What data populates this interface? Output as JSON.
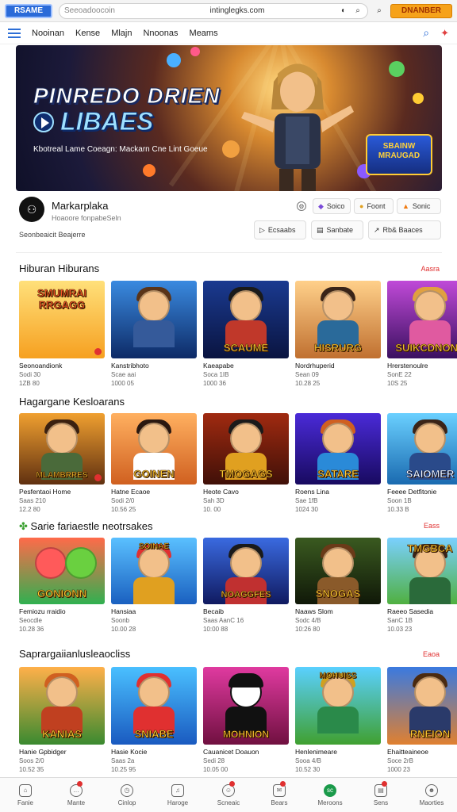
{
  "browser": {
    "logo": "RSAME",
    "search_placeholder": "Seeoadoocoin",
    "url": "intinglegks.com",
    "brand_button": "DNANBER",
    "icons": [
      "pie-chart-icon",
      "search-icon",
      "search-icon",
      "brand-logo"
    ]
  },
  "nav": {
    "items": [
      "Nooinan",
      "Kense",
      "Mlajn",
      "Nnoonas",
      "Meams"
    ],
    "icons": [
      "menu-icon",
      "search-icon",
      "notification-icon"
    ]
  },
  "hero": {
    "title_line1": "PINREDO DRIEN",
    "title_line2": "LIBAES",
    "subtitle": "Kbotreal Lame Coeagn: Mackarn Cne Lint Goeue",
    "sticker": "SBAINW MRAUGAD",
    "colors": {
      "accent": "#9fe0ff",
      "sticker": "#ffd23a"
    }
  },
  "channel": {
    "name": "Markarplaka",
    "subtitle": "Hoaoore fonpabeSeln",
    "description": "Seonbeaicit Beajerre",
    "buttons_top": [
      "Soico",
      "Foont",
      "Sonic"
    ],
    "buttons_bottom": [
      "Ecsaabs",
      "Sanbate",
      "Rb& Baaces"
    ]
  },
  "sections": [
    {
      "title": "Hiburan Hiburans",
      "more": "Aasra",
      "cards": [
        {
          "label": "SMUMRAI RRGAGG",
          "title": "Seonoandionk",
          "meta1": "Sodi 30",
          "meta2": "1ZB 80"
        },
        {
          "label": "",
          "title": "Kanstribhoto",
          "meta1": "Scae aai",
          "meta2": "1000 05"
        },
        {
          "label": "SCAUME",
          "title": "Kaeapabe",
          "meta1": "Soca 1IB",
          "meta2": "1000 36"
        },
        {
          "label": "HISRURG",
          "title": "Nordrhuperid",
          "meta1": "Sean 09",
          "meta2": "10.28 25"
        },
        {
          "label": "SUIKCDNONE",
          "title": "Hrerstenoulre",
          "meta1": "SonE 22",
          "meta2": "10S 25"
        }
      ]
    },
    {
      "title": "Hagargane Kesloarans",
      "more": "",
      "cards": [
        {
          "label": "MLAMBRRES",
          "title": "Pesfentaoi Home",
          "meta1": "Saas 210",
          "meta2": "12.2 80"
        },
        {
          "label": "GOINEN",
          "title": "Hatne Ecaoe",
          "meta1": "Sodi 2/0",
          "meta2": "10.56 25"
        },
        {
          "label": "TMOGAGS",
          "title": "Heote Cavo",
          "meta1": "Sah 3D",
          "meta2": "10. 00"
        },
        {
          "label": "SATARE",
          "title": "Roens Lina",
          "meta1": "Sae 1fB",
          "meta2": "1024 30"
        },
        {
          "label": "SAIOMER",
          "title": "Feeee Detfitonie",
          "meta1": "Soon 1B",
          "meta2": "10.33 B"
        }
      ]
    },
    {
      "title": "Sarie fariaestle neotrsakes",
      "more": "Eass",
      "cards": [
        {
          "label": "GONIONN",
          "title": "Femiozu rraidio",
          "meta1": "Seocdle",
          "meta2": "10.28 36"
        },
        {
          "label": "SOINAE",
          "title": "Hansiaa",
          "meta1": "Soonb",
          "meta2": "10.00 28"
        },
        {
          "label": "NOAGGFES",
          "title": "Becaib",
          "meta1": "Saas AanC 16",
          "meta2": "10:00 88"
        },
        {
          "label": "SNOGAS",
          "title": "Naaws Slom",
          "meta1": "Sodc 4/B",
          "meta2": "10:26 80"
        },
        {
          "label": "TMGBCA",
          "title": "Raeeo Sasedia",
          "meta1": "SanC 1B",
          "meta2": "10.03 23"
        }
      ]
    },
    {
      "title": "Saprargaiianlusleaocliss",
      "more": "Eaoa",
      "cards": [
        {
          "label": "KANIAS",
          "title": "Hanie Gpbidger",
          "meta1": "Soos 2/0",
          "meta2": "10.52 35"
        },
        {
          "label": "SNIABE",
          "title": "Hasie Kocie",
          "meta1": "Saas 2a",
          "meta2": "10.25 95"
        },
        {
          "label": "MOHNION",
          "title": "Cauanicet Doauon",
          "meta1": "Sedi 28",
          "meta2": "10.05 00"
        },
        {
          "label": "MOHUISS",
          "title": "Henlenimeare",
          "meta1": "Sooa 4/B",
          "meta2": "10.52 30"
        },
        {
          "label": "RNEION",
          "title": "Ehaitteaineoe",
          "meta1": "Soce 2rB",
          "meta2": "1000 23"
        }
      ]
    }
  ],
  "bottom_nav": {
    "items": [
      {
        "label": "Fanie",
        "icon": "home-icon",
        "badge": false
      },
      {
        "label": "Mante",
        "icon": "chat-icon",
        "badge": true
      },
      {
        "label": "Cinlop",
        "icon": "clock-icon",
        "badge": false
      },
      {
        "label": "Haroge",
        "icon": "bell-icon",
        "badge": false
      },
      {
        "label": "Scneaic",
        "icon": "user-icon",
        "badge": true
      },
      {
        "label": "Bears",
        "icon": "inbox-icon",
        "badge": true
      },
      {
        "label": "Meroons",
        "icon": "sc-icon",
        "badge": false,
        "icon_text": "sc"
      },
      {
        "label": "Sens",
        "icon": "doc-icon",
        "badge": true
      },
      {
        "label": "Maorties",
        "icon": "profile-icon",
        "badge": false
      }
    ]
  }
}
